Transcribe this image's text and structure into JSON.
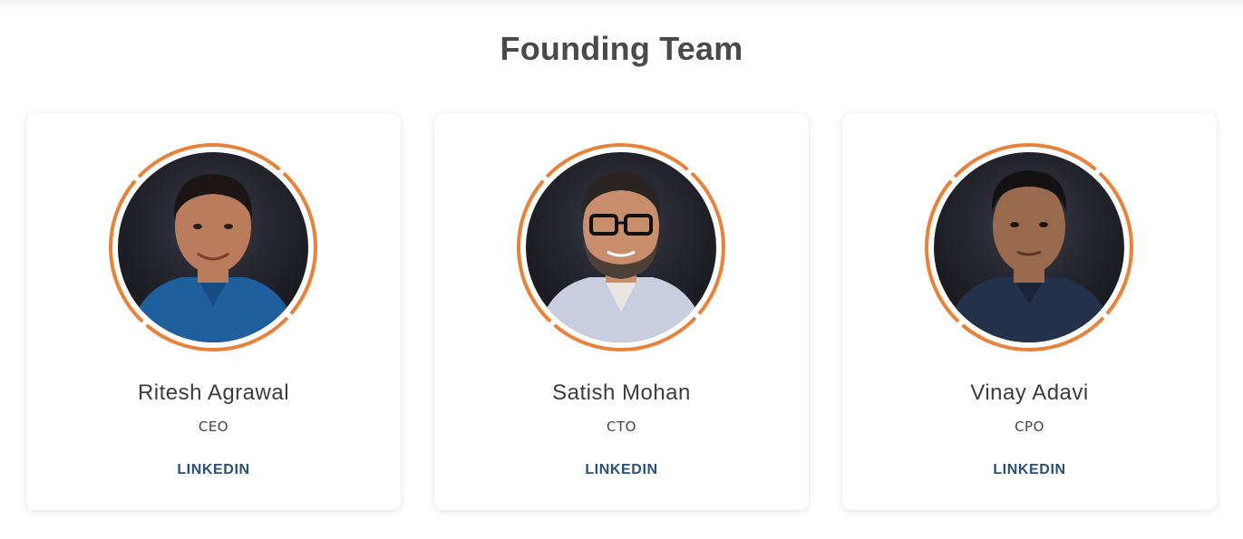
{
  "section": {
    "title": "Founding Team"
  },
  "team": [
    {
      "name": "Ritesh Agrawal",
      "role": "CEO",
      "link_label": "LINKEDIN",
      "shirt_color": "#1f5f9e",
      "skin_color": "#b97c5c",
      "hair_color": "#1b1614"
    },
    {
      "name": "Satish Mohan",
      "role": "CTO",
      "link_label": "LINKEDIN",
      "shirt_color": "#c9cde0",
      "skin_color": "#c98f6c",
      "hair_color": "#2a2522"
    },
    {
      "name": "Vinay Adavi",
      "role": "CPO",
      "link_label": "LINKEDIN",
      "shirt_color": "#23314a",
      "skin_color": "#9a6a4f",
      "hair_color": "#141112"
    }
  ],
  "colors": {
    "accent_ring": "#e8823a",
    "link": "#2b4f75",
    "title": "#4a4a4a"
  }
}
